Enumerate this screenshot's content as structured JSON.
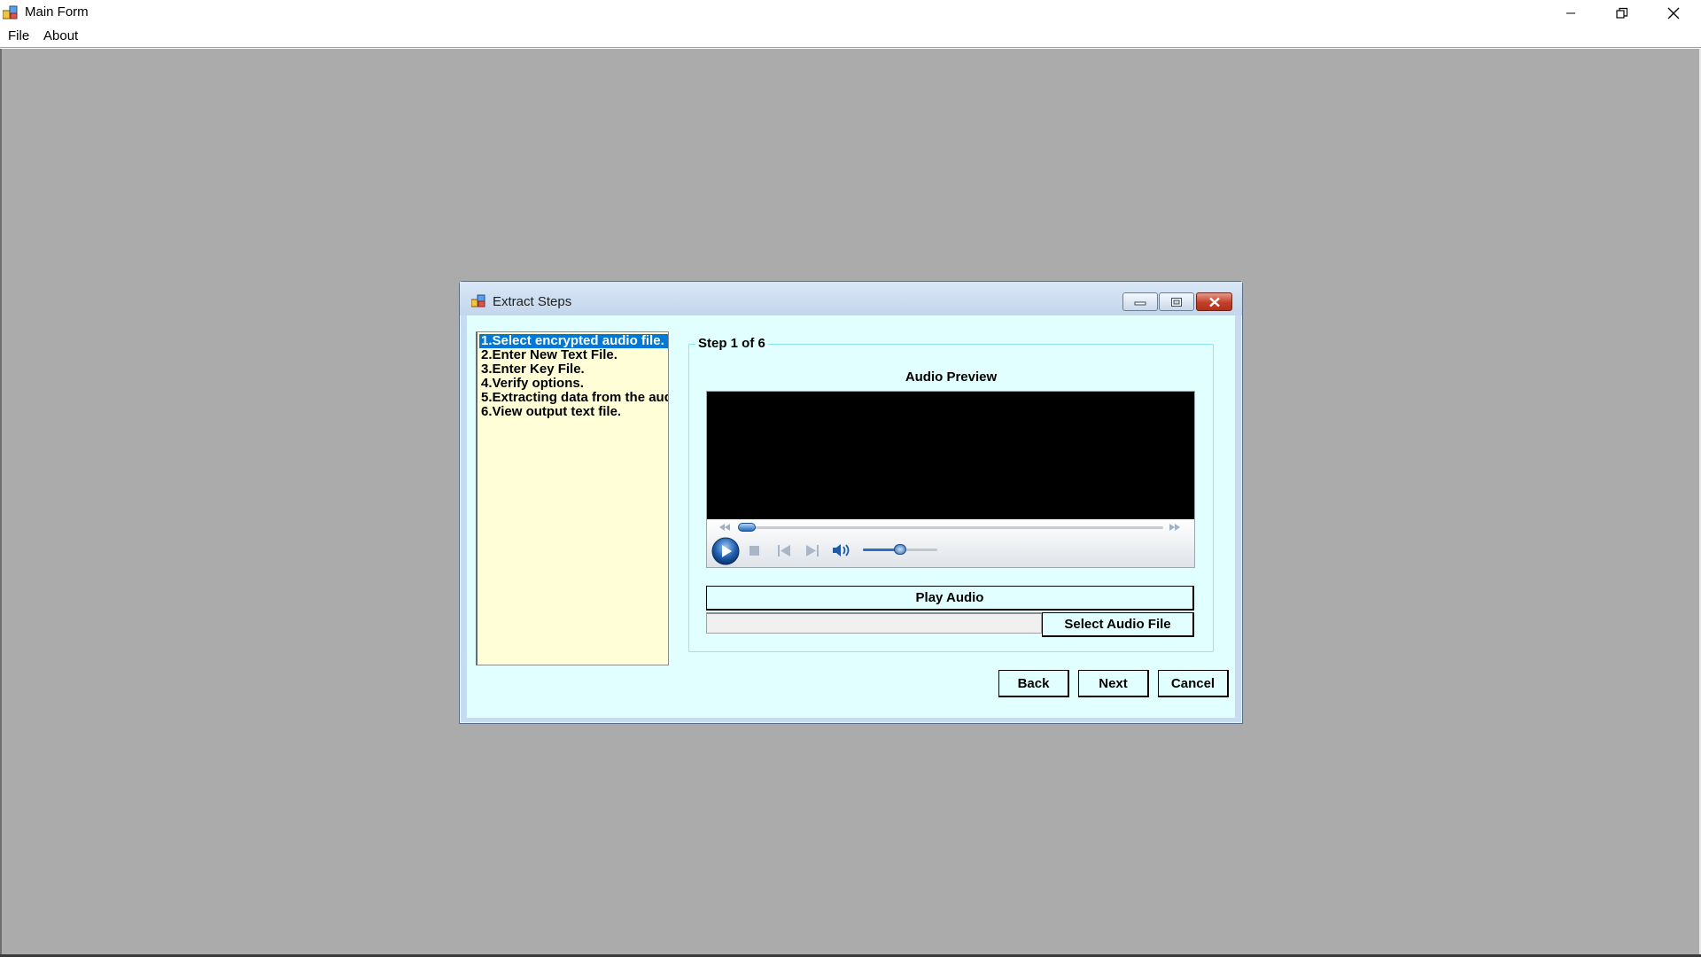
{
  "window": {
    "title": "Main Form",
    "minimize_glyph": "—",
    "restore_glyph": "❐",
    "close_glyph": "✕"
  },
  "menu": {
    "items": [
      {
        "label": "File"
      },
      {
        "label": "About"
      }
    ]
  },
  "dialog": {
    "title": "Extract Steps",
    "steps": [
      {
        "label": "1.Select encrypted audio file.",
        "selected": true
      },
      {
        "label": "2.Enter New Text File.",
        "selected": false
      },
      {
        "label": "3.Enter Key File.",
        "selected": false
      },
      {
        "label": "4.Verify options.",
        "selected": false
      },
      {
        "label": "5.Extracting data from the aud",
        "selected": false
      },
      {
        "label": "6.View output text file.",
        "selected": false
      }
    ],
    "group_title": "Step 1 of 6",
    "audio_preview_label": "Audio Preview",
    "player": {
      "seek_position": 0.0,
      "volume": 0.5
    },
    "play_audio_label": "Play Audio",
    "audio_file_path": "",
    "select_audio_file_label": "Select Audio File",
    "back_label": "Back",
    "next_label": "Next",
    "cancel_label": "Cancel"
  },
  "colors": {
    "dialog_client": "#e1ffff",
    "step_list": "#fffed6",
    "selection": "#0078d7",
    "mdi_background": "#ababab"
  }
}
